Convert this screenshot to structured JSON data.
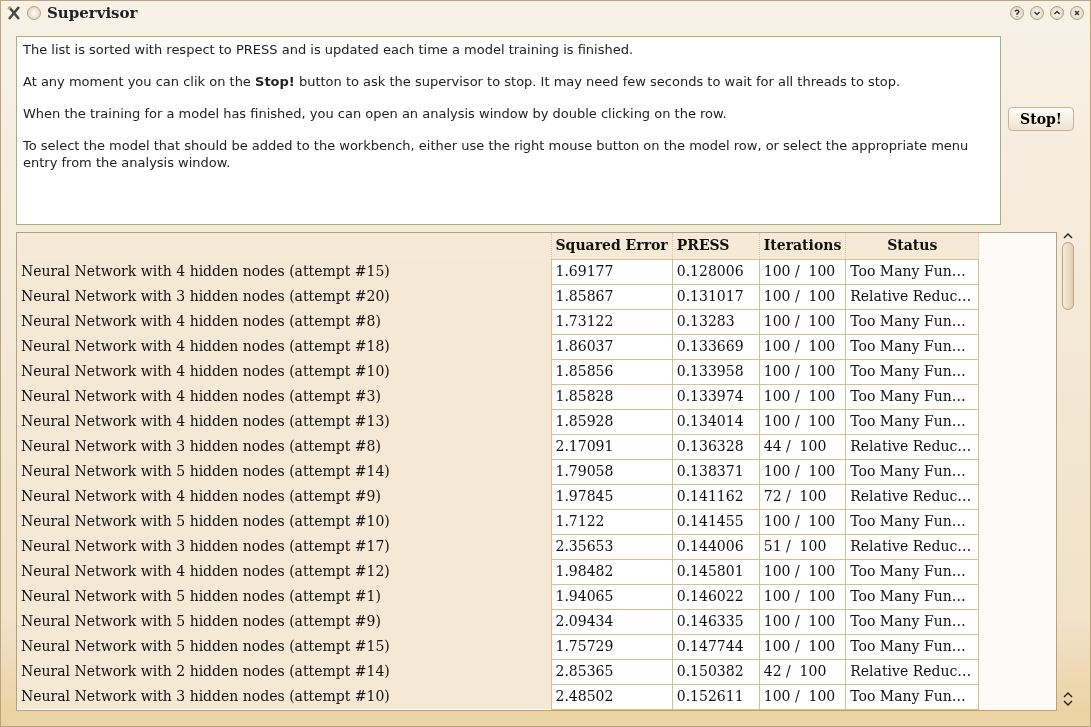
{
  "window": {
    "title": "Supervisor"
  },
  "info": [
    "The list is sorted with respect to PRESS and is updated each time a model training is finished.",
    "At any moment you can clik on the **Stop!** button to ask the supervisor to stop. It may need few seconds to wait for all threads to stop.",
    "When the training for a model has finished, you can open an analysis window by double clicking on the row.",
    "To select the model that should be added to the workbench, either use the right mouse button on the model row, or select the appropriate menu entry from the analysis window."
  ],
  "stop_button": "Stop!",
  "table": {
    "columns": [
      "Squared Error",
      "PRESS",
      "Iterations",
      "Status"
    ],
    "rows": [
      {
        "name": "Neural Network with 4 hidden nodes (attempt #15)",
        "cells": [
          "1.69177",
          "0.128006",
          "100 /  100",
          "Too Many Fun…"
        ]
      },
      {
        "name": "Neural Network with 3 hidden nodes (attempt #20)",
        "cells": [
          "1.85867",
          "0.131017",
          "100 /  100",
          "Relative Reduc…"
        ]
      },
      {
        "name": "Neural Network with 4 hidden nodes (attempt #8)",
        "cells": [
          "1.73122",
          "0.13283",
          "100 /  100",
          "Too Many Fun…"
        ]
      },
      {
        "name": "Neural Network with 4 hidden nodes (attempt #18)",
        "cells": [
          "1.86037",
          "0.133669",
          "100 /  100",
          "Too Many Fun…"
        ]
      },
      {
        "name": "Neural Network with 4 hidden nodes (attempt #10)",
        "cells": [
          "1.85856",
          "0.133958",
          "100 /  100",
          "Too Many Fun…"
        ]
      },
      {
        "name": "Neural Network with 4 hidden nodes (attempt #3)",
        "cells": [
          "1.85828",
          "0.133974",
          "100 /  100",
          "Too Many Fun…"
        ]
      },
      {
        "name": "Neural Network with 4 hidden nodes (attempt #13)",
        "cells": [
          "1.85928",
          "0.134014",
          "100 /  100",
          "Too Many Fun…"
        ]
      },
      {
        "name": "Neural Network with 3 hidden nodes (attempt #8)",
        "cells": [
          "2.17091",
          "0.136328",
          "44 /  100",
          "Relative Reduc…"
        ]
      },
      {
        "name": "Neural Network with 5 hidden nodes (attempt #14)",
        "cells": [
          "1.79058",
          "0.138371",
          "100 /  100",
          "Too Many Fun…"
        ]
      },
      {
        "name": "Neural Network with 4 hidden nodes (attempt #9)",
        "cells": [
          "1.97845",
          "0.141162",
          "72 /  100",
          "Relative Reduc…"
        ]
      },
      {
        "name": "Neural Network with 5 hidden nodes (attempt #10)",
        "cells": [
          "1.7122",
          "0.141455",
          "100 /  100",
          "Too Many Fun…"
        ]
      },
      {
        "name": "Neural Network with 3 hidden nodes (attempt #17)",
        "cells": [
          "2.35653",
          "0.144006",
          "51 /  100",
          "Relative Reduc…"
        ]
      },
      {
        "name": "Neural Network with 4 hidden nodes (attempt #12)",
        "cells": [
          "1.98482",
          "0.145801",
          "100 /  100",
          "Too Many Fun…"
        ]
      },
      {
        "name": "Neural Network with 5 hidden nodes (attempt #1)",
        "cells": [
          "1.94065",
          "0.146022",
          "100 /  100",
          "Too Many Fun…"
        ]
      },
      {
        "name": "Neural Network with 5 hidden nodes (attempt #9)",
        "cells": [
          "2.09434",
          "0.146335",
          "100 /  100",
          "Too Many Fun…"
        ]
      },
      {
        "name": "Neural Network with 5 hidden nodes (attempt #15)",
        "cells": [
          "1.75729",
          "0.147744",
          "100 /  100",
          "Too Many Fun…"
        ]
      },
      {
        "name": "Neural Network with 2 hidden nodes (attempt #14)",
        "cells": [
          "2.85365",
          "0.150382",
          "42 /  100",
          "Relative Reduc…"
        ]
      },
      {
        "name": "Neural Network with 3 hidden nodes (attempt #10)",
        "cells": [
          "2.48502",
          "0.152611",
          "100 /  100",
          "Too Many Fun…"
        ]
      }
    ]
  }
}
